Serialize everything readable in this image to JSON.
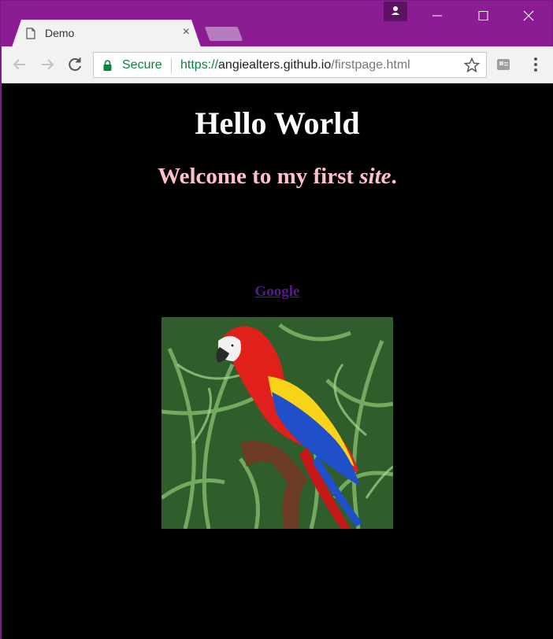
{
  "tab": {
    "title": "Demo",
    "close": "×"
  },
  "toolbar": {
    "secure_label": "Secure",
    "url_scheme": "https://",
    "url_host": "angiealters.github.io",
    "url_path": "/firstpage.html"
  },
  "window_controls": {
    "minimize": "—",
    "maximize": "☐",
    "close": "✕"
  },
  "page": {
    "heading": "Hello World",
    "welcome_text": "Welcome to my first ",
    "welcome_emphasis": "site",
    "welcome_end": ".",
    "link_text": "Google",
    "image_alt": "Scarlet macaw parrot"
  },
  "colors": {
    "frame": "#8b1c93",
    "page_background": "#000000",
    "heading": "#ffffff",
    "welcome": "#ffc0cb",
    "link": "#551a8b",
    "secure_green": "#0b8043"
  },
  "icons": [
    "document-icon",
    "lock-icon",
    "star-icon",
    "profile-icon",
    "back-icon",
    "forward-icon",
    "reload-icon",
    "extension-icon",
    "menu-icon"
  ]
}
